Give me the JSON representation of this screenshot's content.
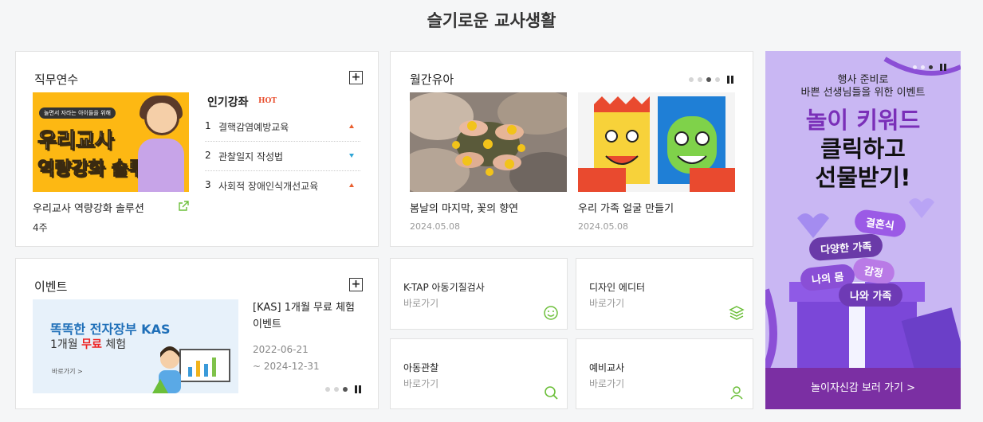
{
  "page_title": "슬기로운 교사생활",
  "duty": {
    "title": "직무연수",
    "plus": "+",
    "banner": {
      "pill": "놀면서 자라는 아이들을 위해",
      "line1": "우리교사",
      "line2": "역량강화 솔루션"
    },
    "course_name": "우리교사 역량강화 솔루션",
    "course_week": "4주",
    "popular_title": "인기강좌",
    "hot": "HOT",
    "rankings": [
      {
        "num": "1",
        "text": "결핵감염예방교육",
        "trend": "up"
      },
      {
        "num": "2",
        "text": "관찰일지 작성법",
        "trend": "down"
      },
      {
        "num": "3",
        "text": "사회적 장애인식개선교육",
        "trend": "up"
      }
    ]
  },
  "monthly": {
    "title": "월간유아",
    "items": [
      {
        "caption": "봄날의 마지막, 꽃의 향연",
        "date": "2024.05.08"
      },
      {
        "caption": "우리 가족 얼굴 만들기",
        "date": "2024.05.08"
      }
    ]
  },
  "event": {
    "title": "이벤트",
    "plus": "+",
    "banner": {
      "line1": "똑똑한 전자장부 KAS",
      "line2_a": "1개월 ",
      "line2_b": "무료",
      "line2_c": " 체험",
      "go": "바로가기 >"
    },
    "event_title": "[KAS] 1개월 무료 체험 이벤트",
    "date_start": "2022-06-21",
    "date_end": "~ 2024-12-31"
  },
  "links": [
    {
      "title": "K-TAP 아동기질검사",
      "sub": "바로가기",
      "icon": "smile-icon"
    },
    {
      "title": "디자인 에디터",
      "sub": "바로가기",
      "icon": "layers-icon"
    },
    {
      "title": "아동관찰",
      "sub": "바로가기",
      "icon": "search-icon"
    },
    {
      "title": "예비교사",
      "sub": "바로가기",
      "icon": "user-icon"
    }
  ],
  "ad": {
    "top1": "행사 준비로",
    "top2": "바쁜 선생님들을 위한 이벤트",
    "big1": "놀이 키워드",
    "big2": "클릭하고",
    "big3": "선물받기!",
    "keywords": [
      "결혼식",
      "다양한 가족",
      "감정",
      "나의 몸",
      "나와 가족"
    ],
    "cta": "놀이자신감 보러 가기 >"
  },
  "colors": {
    "accent_green": "#6cbf3a",
    "hot_red": "#e94f2f",
    "ad_purple": "#7b2fa3",
    "ad_bg": "#c9b7f3"
  }
}
